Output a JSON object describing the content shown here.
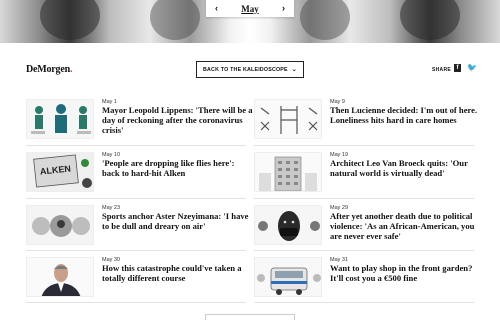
{
  "nav": {
    "month": "May",
    "prev_arrow": "‹",
    "next_arrow": "›"
  },
  "header": {
    "logo": "DeMorgen",
    "logo_dot": ".",
    "back_label": "BACK TO THE KALEIDOSCOPE",
    "back_chevron": "⌄",
    "share_label": "SHARE",
    "facebook": "f",
    "twitter": "🐦"
  },
  "articles": [
    {
      "date": "May 1",
      "title": "Mayor Leopold Lippens: 'There will be a day of reckoning after the coronavirus crisis'"
    },
    {
      "date": "May 9",
      "title": "Then Lucienne decided: I'm out of here. Loneliness hits hard in care homes"
    },
    {
      "date": "May 10",
      "title": "'People are dropping like flies here': back to hard-hit Alken"
    },
    {
      "date": "May 19",
      "title": "Architect Leo Van Broeck quits: 'Our natural world is virtually dead'"
    },
    {
      "date": "May 23",
      "title": "Sports anchor Aster Nzeyimana: 'I have to be dull and dreary on air'"
    },
    {
      "date": "May 29",
      "title": "After yet another death due to political violence: 'As an African-American, you are never ever safe'"
    },
    {
      "date": "May 30",
      "title": "How this catastrophe could've taken a totally different course"
    },
    {
      "date": "May 31",
      "title": "Want to play shop in the front garden? It'll cost you a €500 fine"
    }
  ],
  "thumb_text": {
    "alken": "ALKEN"
  },
  "colors": {
    "logo_dot": "#e03a3a",
    "text": "#111111",
    "separator": "#e2e2e2"
  }
}
